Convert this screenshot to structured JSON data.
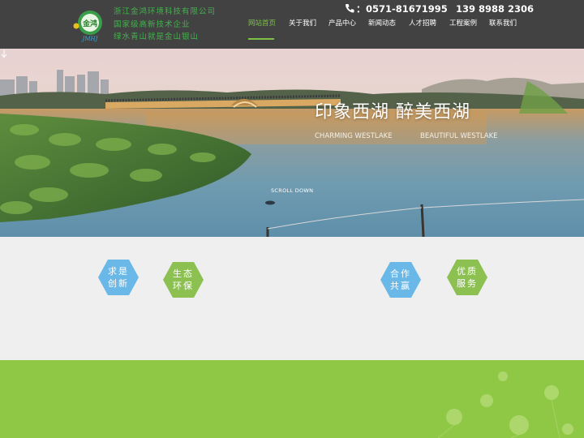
{
  "company": {
    "logo_text": "金鸿",
    "logo_sub": "JMHJ",
    "name": "浙江金鸿环境科技有限公司",
    "tagline1": "国家级高新技术企业",
    "tagline2": "绿水青山就是金山银山"
  },
  "contact": {
    "phone_label": "：",
    "phone": "0571-81671995",
    "mobile": "139 8988 2306"
  },
  "nav": {
    "items": [
      {
        "label": "网站首页",
        "active": true
      },
      {
        "label": "关于我们"
      },
      {
        "label": "产品中心"
      },
      {
        "label": "新闻动态"
      },
      {
        "label": "人才招聘"
      },
      {
        "label": "工程案例"
      },
      {
        "label": "联系我们"
      }
    ]
  },
  "banner": {
    "title": "印象西湖 醉美西湖",
    "subtitle_left": "CHARMING WESTLAKE",
    "subtitle_right": "BEAUTIFUL WESTLAKE",
    "scroll": "SCROLL DOWN"
  },
  "features": [
    {
      "line1": "求是",
      "line2": "创新",
      "color": "#6ab8e8"
    },
    {
      "line1": "生态",
      "line2": "环保",
      "color": "#8cc152"
    },
    {
      "line1": "合作",
      "line2": "共赢",
      "color": "#6ab8e8"
    },
    {
      "line1": "优质",
      "line2": "服务",
      "color": "#8cc152"
    }
  ],
  "colors": {
    "header_bg": "#424242",
    "accent_green": "#7cc046",
    "feature_bg": "#efefef",
    "bottom_green": "#8fc844"
  }
}
